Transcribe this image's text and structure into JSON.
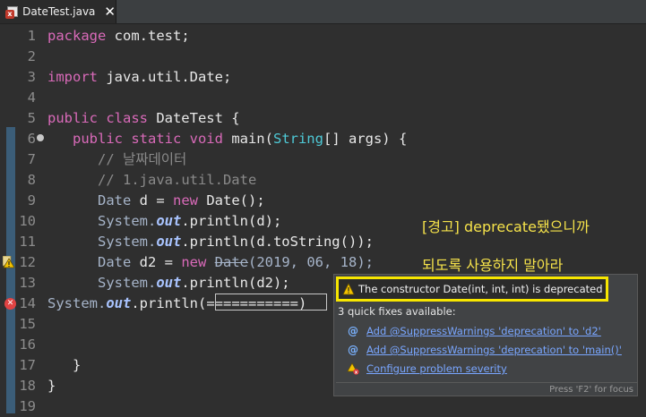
{
  "tab": {
    "title": "DateTest.java",
    "close": "✕"
  },
  "lines": [
    {
      "n": "1"
    },
    {
      "n": "2"
    },
    {
      "n": "3"
    },
    {
      "n": "4"
    },
    {
      "n": "5"
    },
    {
      "n": "6"
    },
    {
      "n": "7"
    },
    {
      "n": "8"
    },
    {
      "n": "9"
    },
    {
      "n": "10"
    },
    {
      "n": "11"
    },
    {
      "n": "12"
    },
    {
      "n": "13"
    },
    {
      "n": "14"
    },
    {
      "n": "15"
    },
    {
      "n": "16"
    },
    {
      "n": "17"
    },
    {
      "n": "18"
    },
    {
      "n": "19"
    }
  ],
  "code": {
    "l1_kw": "package",
    "l1_rest": " com.test;",
    "l3_kw": "import",
    "l3_rest": " java.util.Date;",
    "l5_kw": "public class",
    "l5_rest": " DateTest {",
    "l6_kw": "public static void",
    "l6_name": " main(",
    "l6_type": "String",
    "l6_rest": "[] args) {",
    "l7": "// 날짜데이터",
    "l8": "// 1.java.util.Date",
    "l9_type": "Date",
    "l9_mid": " d = ",
    "l9_kw": "new",
    "l9_rest": " Date();",
    "l10_a": "System.",
    "l10_f": "out",
    "l10_b": ".println(d);",
    "l11_a": "System.",
    "l11_f": "out",
    "l11_b": ".println(d.toString());",
    "l12_type": "Date",
    "l12_mid": " d2 = ",
    "l12_kw": "new",
    "l12_dep": "Date",
    "l12_rest": "(2019, 06, 18);",
    "l13_a": "System.",
    "l13_f": "out",
    "l13_b": ".println(d2);",
    "l14_a": "System.",
    "l14_f": "out",
    "l14_b": ".println(",
    "l14_c": "===========",
    "l17": "}",
    "l18": "}"
  },
  "annotations": {
    "a1": "[경고] deprecate됐으니까",
    "a2": "되도록 사용하지 말아라"
  },
  "popup": {
    "message": "The constructor Date(int, int, int) is deprecated",
    "subtitle": "3 quick fixes available:",
    "fixes": [
      {
        "label": "Add @SuppressWarnings 'deprecation' to 'd2'"
      },
      {
        "label": "Add @SuppressWarnings 'deprecation' to 'main()'"
      },
      {
        "label": "Configure problem severity"
      }
    ],
    "footer": "Press 'F2' for focus"
  },
  "icons": {
    "tab": "java-file-error-icon",
    "warning": "warning-icon",
    "error": "error-icon",
    "fix": "quick-fix-icon",
    "configure": "configure-severity-icon"
  },
  "colors": {
    "background": "#2f2f2f",
    "keyword": "#d96ab9",
    "class": "#4ec9d6",
    "field": "#a9c4ff",
    "annotation": "#f5e24a",
    "highlight": "#f7e600",
    "link": "#79a6ff"
  }
}
